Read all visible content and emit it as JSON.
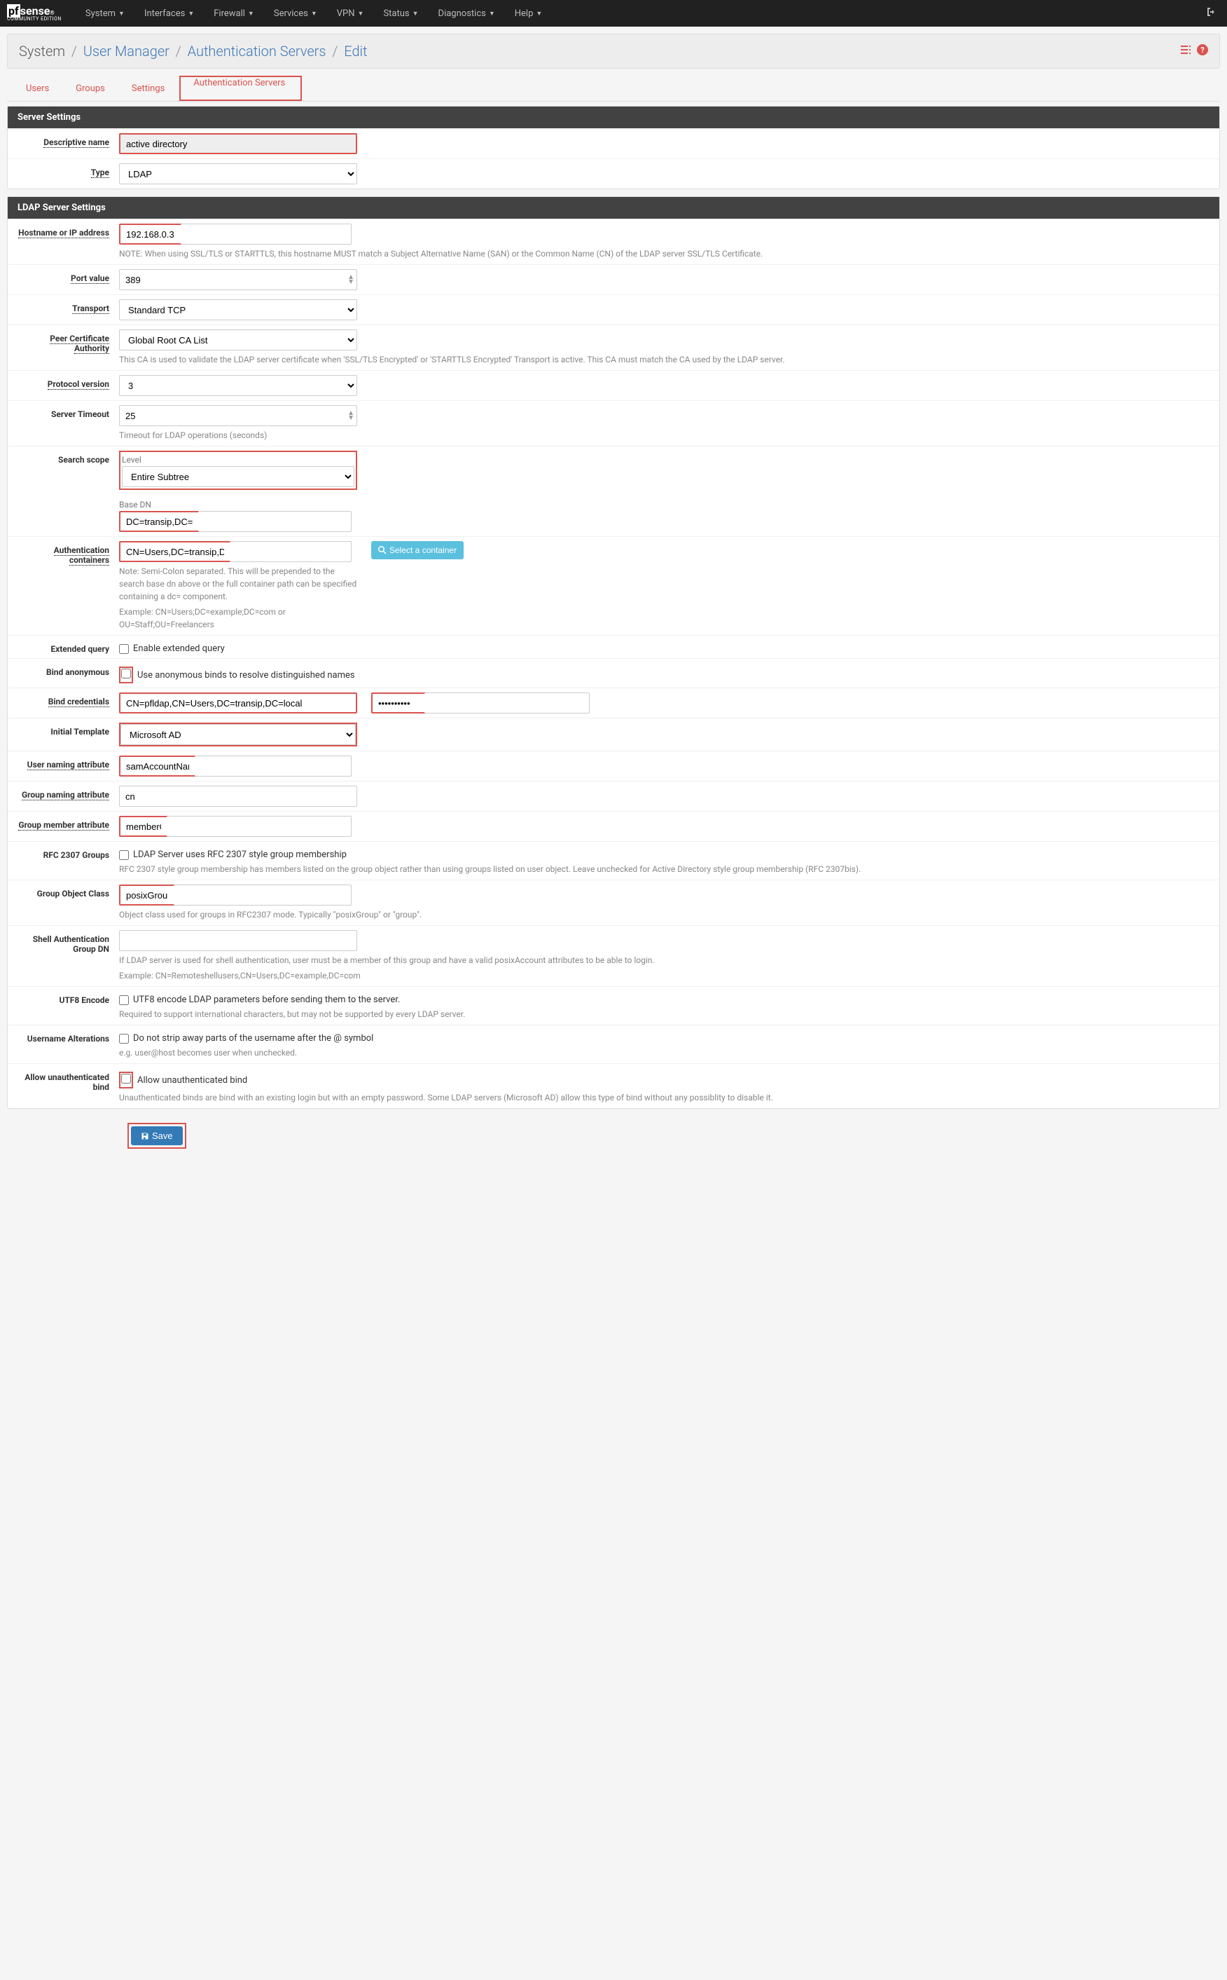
{
  "brand": {
    "main": "pfsense",
    "sub": "COMMUNITY EDITION"
  },
  "nav": {
    "system": "System",
    "interfaces": "Interfaces",
    "firewall": "Firewall",
    "services": "Services",
    "vpn": "VPN",
    "status": "Status",
    "diagnostics": "Diagnostics",
    "help": "Help"
  },
  "breadcrumb": {
    "system": "System",
    "usermgr": "User Manager",
    "authsrv": "Authentication Servers",
    "edit": "Edit"
  },
  "tabs": {
    "users": "Users",
    "groups": "Groups",
    "settings": "Settings",
    "authservers": "Authentication Servers"
  },
  "panels": {
    "server_settings": "Server Settings",
    "ldap_settings": "LDAP Server Settings"
  },
  "labels": {
    "descriptive_name": "Descriptive name",
    "type": "Type",
    "hostname": "Hostname or IP address",
    "port": "Port value",
    "transport": "Transport",
    "peer_ca": "Peer Certificate Authority",
    "proto": "Protocol version",
    "timeout": "Server Timeout",
    "scope": "Search scope",
    "level": "Level",
    "basedn": "Base DN",
    "authcontainers": "Authentication containers",
    "extquery": "Extended query",
    "bindanon": "Bind anonymous",
    "bindcred": "Bind credentials",
    "inittpl": "Initial Template",
    "userattr": "User naming attribute",
    "groupattr": "Group naming attribute",
    "memberattr": "Group member attribute",
    "rfc2307": "RFC 2307 Groups",
    "groupclass": "Group Object Class",
    "shelldn": "Shell Authentication Group DN",
    "utf8": "UTF8 Encode",
    "useralter": "Username Alterations",
    "unauth": "Allow unauthenticated bind"
  },
  "values": {
    "descriptive_name": "active directory",
    "type": "LDAP",
    "hostname": "192.168.0.3",
    "port": "389",
    "transport": "Standard TCP",
    "peer_ca": "Global Root CA List",
    "proto": "3",
    "timeout": "25",
    "level": "Entire Subtree",
    "basedn": "DC=transip,DC=local",
    "authcontainers": "CN=Users,DC=transip,DC=local",
    "bindcred_user": "CN=pfldap,CN=Users,DC=transip,DC=local",
    "bindcred_pass": "••••••••••",
    "inittpl": "Microsoft AD",
    "userattr": "samAccountName",
    "groupattr": "cn",
    "memberattr": "memberOf",
    "groupclass": "posixGroup",
    "shelldn": ""
  },
  "cblabels": {
    "extquery": "Enable extended query",
    "bindanon": "Use anonymous binds to resolve distinguished names",
    "rfc2307": "LDAP Server uses RFC 2307 style group membership",
    "utf8": "UTF8 encode LDAP parameters before sending them to the server.",
    "useralter": "Do not strip away parts of the username after the @ symbol",
    "unauth": "Allow unauthenticated bind"
  },
  "help": {
    "hostname": "NOTE: When using SSL/TLS or STARTTLS, this hostname MUST match a Subject Alternative Name (SAN) or the Common Name (CN) of the LDAP server SSL/TLS Certificate.",
    "peer_ca": "This CA is used to validate the LDAP server certificate when 'SSL/TLS Encrypted' or 'STARTTLS Encrypted' Transport is active. This CA must match the CA used by the LDAP server.",
    "timeout": "Timeout for LDAP operations (seconds)",
    "authcontainers": "Note: Semi-Colon separated. This will be prepended to the search base dn above or the full container path can be specified containing a dc= component.",
    "authcontainers2": "Example: CN=Users;DC=example;DC=com or OU=Staff;OU=Freelancers",
    "rfc2307": "RFC 2307 style group membership has members listed on the group object rather than using groups listed on user object. Leave unchecked for Active Directory style group membership (RFC 2307bis).",
    "groupclass": "Object class used for groups in RFC2307 mode. Typically \"posixGroup\" or \"group\".",
    "shelldn": "If LDAP server is used for shell authentication, user must be a member of this group and have a valid posixAccount attributes to be able to login.",
    "shelldn2": "Example: CN=Remoteshellusers,CN=Users,DC=example,DC=com",
    "utf8": "Required to support international characters, but may not be supported by every LDAP server.",
    "useralter": "e.g. user@host becomes user when unchecked.",
    "unauth": "Unauthenticated binds are bind with an existing login but with an empty password. Some LDAP servers (Microsoft AD) allow this type of bind without any possiblity to disable it."
  },
  "buttons": {
    "select_container": "Select a container",
    "save": "Save"
  }
}
